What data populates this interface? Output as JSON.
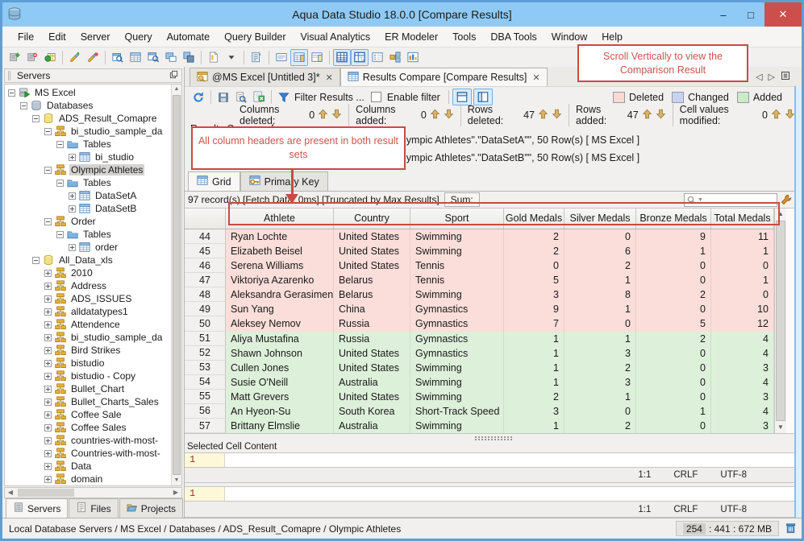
{
  "window": {
    "title": "Aqua Data Studio 18.0.0 [Compare Results]",
    "controls": {
      "minimize": "–",
      "maximize": "□",
      "close": "✕"
    }
  },
  "menu": {
    "items": [
      "File",
      "Edit",
      "Server",
      "Query",
      "Automate",
      "Query Builder",
      "Visual Analytics",
      "ER Modeler",
      "Tools",
      "DBA Tools",
      "Window",
      "Help"
    ]
  },
  "main_toolbar": {
    "icons": [
      {
        "name": "register-server-icon"
      },
      {
        "name": "unregister-server-icon"
      },
      {
        "name": "server-connect-icon"
      },
      "|",
      {
        "name": "new-query-analyzer-icon"
      },
      {
        "name": "close-query-analyzer-icon"
      },
      "|",
      {
        "name": "open-results-icon"
      },
      {
        "name": "query-window-icon"
      },
      {
        "name": "query-results-icon"
      },
      {
        "name": "detach-window-icon"
      },
      {
        "name": "copy-grid-icon"
      },
      "|",
      {
        "name": "new-file-icon"
      },
      {
        "name": "file-dropdown-icon"
      },
      "|",
      {
        "name": "script-window-icon"
      },
      "|",
      {
        "name": "text-view-icon"
      },
      {
        "name": "grid-panel-view-icon",
        "selected": true
      },
      {
        "name": "grid-form-view-icon"
      },
      "|",
      {
        "name": "grid-view-icon",
        "selected": true
      },
      {
        "name": "pivot-grid-view-icon",
        "selected": true
      },
      {
        "name": "form-view-icon"
      },
      {
        "name": "er-view-icon"
      },
      {
        "name": "chart-view-icon"
      }
    ]
  },
  "sidebar": {
    "title": "Servers",
    "tree": [
      {
        "label": "MS Excel",
        "depth": 0,
        "icon": "server",
        "expander": "minus"
      },
      {
        "label": "Databases",
        "depth": 1,
        "icon": "databases",
        "expander": "minus"
      },
      {
        "label": "ADS_Result_Comapre",
        "depth": 2,
        "icon": "db-yellow",
        "expander": "minus"
      },
      {
        "label": "bi_studio_sample_da",
        "depth": 3,
        "icon": "schema",
        "expander": "minus"
      },
      {
        "label": "Tables",
        "depth": 4,
        "icon": "folder",
        "expander": "minus"
      },
      {
        "label": "bi_studio",
        "depth": 5,
        "icon": "table",
        "expander": "plus"
      },
      {
        "label": "Olympic Athletes",
        "depth": 3,
        "icon": "schema",
        "expander": "minus",
        "selected": true
      },
      {
        "label": "Tables",
        "depth": 4,
        "icon": "folder",
        "expander": "minus"
      },
      {
        "label": "DataSetA",
        "depth": 5,
        "icon": "table",
        "expander": "plus"
      },
      {
        "label": "DataSetB",
        "depth": 5,
        "icon": "table",
        "expander": "plus"
      },
      {
        "label": "Order",
        "depth": 3,
        "icon": "schema",
        "expander": "minus"
      },
      {
        "label": "Tables",
        "depth": 4,
        "icon": "folder",
        "expander": "minus"
      },
      {
        "label": "order",
        "depth": 5,
        "icon": "table",
        "expander": "plus"
      },
      {
        "label": "All_Data_xls",
        "depth": 2,
        "icon": "db-yellow",
        "expander": "minus"
      },
      {
        "label": "2010",
        "depth": 3,
        "icon": "schema",
        "expander": "plus"
      },
      {
        "label": "Address",
        "depth": 3,
        "icon": "schema",
        "expander": "plus"
      },
      {
        "label": "ADS_ISSUES",
        "depth": 3,
        "icon": "schema",
        "expander": "plus"
      },
      {
        "label": "alldatatypes1",
        "depth": 3,
        "icon": "schema",
        "expander": "plus"
      },
      {
        "label": "Attendence",
        "depth": 3,
        "icon": "schema",
        "expander": "plus"
      },
      {
        "label": "bi_studio_sample_da",
        "depth": 3,
        "icon": "schema",
        "expander": "plus"
      },
      {
        "label": "Bird Strikes",
        "depth": 3,
        "icon": "schema",
        "expander": "plus"
      },
      {
        "label": "bistudio",
        "depth": 3,
        "icon": "schema",
        "expander": "plus"
      },
      {
        "label": "bistudio - Copy",
        "depth": 3,
        "icon": "schema",
        "expander": "plus"
      },
      {
        "label": "Bullet_Chart",
        "depth": 3,
        "icon": "schema",
        "expander": "plus"
      },
      {
        "label": "Bullet_Charts_Sales",
        "depth": 3,
        "icon": "schema",
        "expander": "plus"
      },
      {
        "label": "Coffee Sale",
        "depth": 3,
        "icon": "schema",
        "expander": "plus"
      },
      {
        "label": "Coffee Sales",
        "depth": 3,
        "icon": "schema",
        "expander": "plus"
      },
      {
        "label": "countries-with-most-",
        "depth": 3,
        "icon": "schema",
        "expander": "plus"
      },
      {
        "label": "Countries-with-most-",
        "depth": 3,
        "icon": "schema",
        "expander": "plus"
      },
      {
        "label": "Data",
        "depth": 3,
        "icon": "schema",
        "expander": "plus"
      },
      {
        "label": "domain",
        "depth": 3,
        "icon": "schema",
        "expander": "plus"
      }
    ],
    "tabs": [
      {
        "label": "Servers",
        "icon": "server-rack",
        "active": true
      },
      {
        "label": "Files",
        "icon": "scroll"
      },
      {
        "label": "Projects",
        "icon": "folder-open"
      }
    ]
  },
  "doc_tabs": [
    {
      "label": "@MS Excel [Untitled 3]*",
      "icon": "query-tab",
      "close": "✕"
    },
    {
      "label": "Results Compare [Compare Results]",
      "icon": "compare-tab",
      "close": "✕",
      "active": true
    }
  ],
  "compare_toolbar": {
    "filter_label": "Filter Results ...",
    "enable_filter_label": "Enable filter",
    "legend": [
      {
        "label": "Deleted",
        "color": "#fbd8d3"
      },
      {
        "label": "Changed",
        "color": "#c7d3f0"
      },
      {
        "label": "Added",
        "color": "#c9ebc6"
      }
    ]
  },
  "counters": [
    {
      "label": "Columns deleted:",
      "value": "0"
    },
    {
      "label": "Columns added:",
      "value": "0"
    },
    {
      "label": "Rows deleted:",
      "value": "47"
    },
    {
      "label": "Rows added:",
      "value": "47"
    },
    {
      "label": "Cell values modified:",
      "value": "0"
    }
  ],
  "results": {
    "heading": "Results Compare for",
    "lines": [
      "lympic Athletes\".\"DataSetA\"\", 50 Row(s)  [ MS Excel ]",
      "lympic Athletes\".\"DataSetB\"\", 50 Row(s)  [ MS Excel ]"
    ]
  },
  "annotations": {
    "scroll_note": "Scroll Vertically to view the Comparison Result",
    "headers_note": "All column headers are present in both result sets"
  },
  "grid_tabs": [
    {
      "label": "Grid",
      "icon": "grid-blue",
      "active": true
    },
    {
      "label": "Primary Key",
      "icon": "key-grid"
    }
  ],
  "record_bar": {
    "info": "97 record(s) [Fetch Data: 0ms]  [Truncated by Max Results]",
    "sum_label": "Sum:",
    "search_placeholder": ""
  },
  "table": {
    "columns": [
      "",
      "Athlete",
      "Country",
      "Sport",
      "Gold Medals",
      "Silver Medals",
      "Bronze Medals",
      "Total Medals"
    ],
    "rows": [
      {
        "num": "44",
        "cells": [
          "Ryan Lochte",
          "United States",
          "Swimming",
          "2",
          "0",
          "9",
          "11"
        ],
        "status": "deleted"
      },
      {
        "num": "45",
        "cells": [
          "Elizabeth Beisel",
          "United States",
          "Swimming",
          "2",
          "6",
          "1",
          "1"
        ],
        "status": "deleted"
      },
      {
        "num": "46",
        "cells": [
          "Serena Williams",
          "United States",
          "Tennis",
          "0",
          "2",
          "0",
          "0"
        ],
        "status": "deleted"
      },
      {
        "num": "47",
        "cells": [
          "Viktoriya Azarenko",
          "Belarus",
          "Tennis",
          "5",
          "1",
          "0",
          "1"
        ],
        "status": "deleted"
      },
      {
        "num": "48",
        "cells": [
          "Aleksandra Gerasimenya",
          "Belarus",
          "Swimming",
          "3",
          "8",
          "2",
          "0"
        ],
        "status": "deleted"
      },
      {
        "num": "49",
        "cells": [
          "Sun Yang",
          "China",
          "Gymnastics",
          "9",
          "1",
          "0",
          "10"
        ],
        "status": "deleted"
      },
      {
        "num": "50",
        "cells": [
          "Aleksey Nemov",
          "Russia",
          "Gymnastics",
          "7",
          "0",
          "5",
          "12"
        ],
        "status": "deleted"
      },
      {
        "num": "51",
        "cells": [
          "Aliya Mustafina",
          "Russia",
          "Gymnastics",
          "1",
          "1",
          "2",
          "4"
        ],
        "status": "added"
      },
      {
        "num": "52",
        "cells": [
          "Shawn Johnson",
          "United States",
          "Gymnastics",
          "1",
          "3",
          "0",
          "4"
        ],
        "status": "added"
      },
      {
        "num": "53",
        "cells": [
          "Cullen Jones",
          "United States",
          "Swimming",
          "1",
          "2",
          "0",
          "3"
        ],
        "status": "added"
      },
      {
        "num": "54",
        "cells": [
          "Susie O'Neill",
          "Australia",
          "Swimming",
          "1",
          "3",
          "0",
          "4"
        ],
        "status": "added"
      },
      {
        "num": "55",
        "cells": [
          "Matt Grevers",
          "United States",
          "Swimming",
          "2",
          "1",
          "0",
          "3"
        ],
        "status": "added"
      },
      {
        "num": "56",
        "cells": [
          "An Hyeon-Su",
          "South Korea",
          "Short-Track Speed",
          "3",
          "0",
          "1",
          "4"
        ],
        "status": "added"
      },
      {
        "num": "57",
        "cells": [
          "Brittany Elmslie",
          "Australia",
          "Swimming",
          "1",
          "2",
          "0",
          "3"
        ],
        "status": "added"
      }
    ]
  },
  "cell_content": {
    "label": "Selected Cell Content",
    "editors": [
      {
        "line_number": "1",
        "position": "1:1",
        "line_ending": "CRLF",
        "encoding": "UTF-8"
      },
      {
        "line_number": "1",
        "position": "1:1",
        "line_ending": "CRLF",
        "encoding": "UTF-8"
      }
    ]
  },
  "footer": {
    "breadcrumb": "Local Database Servers / MS Excel / Databases / ADS_Result_Comapre / Olympic Athletes",
    "mem_used": "254",
    "mem_detail": ": 441 : 672 MB"
  }
}
